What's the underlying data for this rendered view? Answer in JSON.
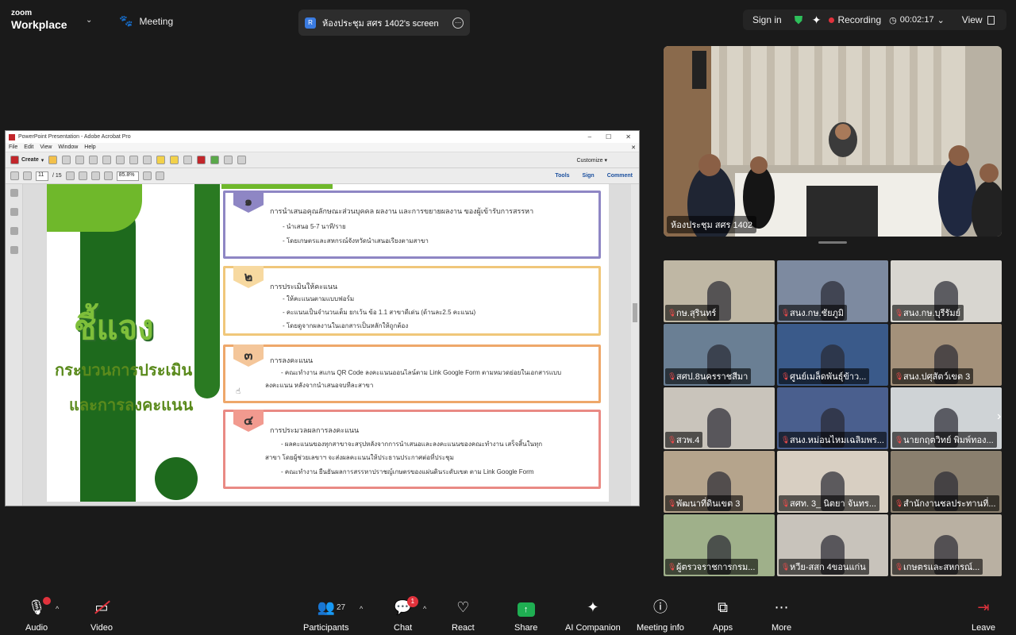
{
  "app": {
    "logo_line1": "zoom",
    "logo_line2": "Workplace",
    "meeting_label": "Meeting",
    "share_tab_label": "ห้องประชุม สศร 1402's screen",
    "share_tab_icon": "R"
  },
  "status": {
    "signin": "Sign in",
    "recording": "Recording",
    "timer": "00:02:17",
    "view": "View"
  },
  "acrobat": {
    "title": "PowerPoint Presentation - Adobe Acrobat Pro",
    "menu": [
      "File",
      "Edit",
      "View",
      "Window",
      "Help"
    ],
    "create": "Create",
    "customize": "Customize",
    "page_current": "11",
    "page_total": "/ 15",
    "zoom": "85.8%",
    "tools": "Tools",
    "sign": "Sign",
    "comment": "Comment"
  },
  "slide": {
    "title_main": "ชี้แจง",
    "title_sub1": "กระบวนการประเมิน",
    "title_sub2": "และการลงคะแนน",
    "cards": [
      {
        "num": "๑",
        "title": "การนำเสนอคุณลักษณะส่วนบุคคล ผลงาน และการขยายผลงาน ของผู้เข้ารับการสรรหา",
        "lines": [
          "- นำเสนอ 5-7 นาที/ราย",
          "- โดยเกษตรและสหกรณ์จังหวัดนำเสนอเรียงตามสาขา"
        ]
      },
      {
        "num": "๒",
        "title": "การประเมินให้คะแนน",
        "lines": [
          "- ให้คะแนนตามแบบฟอร์ม",
          "- คะแนนเป็นจำนวนเต็ม ยกเว้น ข้อ 1.1 สาขาดีเด่น (ด้านละ2.5 คะแนน)",
          "- โดยดูจากผลงานในเอกสารเป็นหลักให้ถูกต้อง"
        ]
      },
      {
        "num": "๓",
        "title": "การลงคะแนน",
        "lines": [
          "- คณะทำงาน สแกน QR Code ลงคะแนนออนไลน์ตาม  Link Google Form ตามหมวดย่อยในเอกสารแบบ",
          "ลงคะแนน หลังจากนำเสนอจบทีละสาขา"
        ]
      },
      {
        "num": "๔",
        "title": "การประมวลผลการลงคะแนน",
        "lines": [
          "- ผลคะแนนของทุกสาขาจะสรุปหลังจากการนำเสนอและลงคะแนนของคณะทำงาน เสร็จสิ้นในทุก",
          "สาขา โดยผู้ช่วยเลขาฯ จะส่งผลคะแนนให้ประธานประกาศต่อที่ประชุม",
          "- คณะทำงาน ยืนยันผลการสรรหาปราชญ์เกษตรของแผ่นดินระดับเขต ตาม Link Google Form"
        ]
      }
    ]
  },
  "active_speaker": {
    "name": "ห้องประชุม สศร 1402"
  },
  "participants_grid": [
    "กษ.สุรินทร์",
    "สนง.กษ.ชัยภูมิ",
    "สนง.กษ.บุรีรัมย์",
    "สศป.8นครราชสีมา",
    "ศูนย์เมล็ดพันธุ์ข้าว...",
    "สนง.ปศุสัตว์เขต 3",
    "สวพ.4",
    "สนง.หม่อนไหมเฉลิมพร...",
    "นายกฤตวิทย์ พิมพ์ทอง...",
    "พัฒนาที่ดินเขต 3",
    "สศท. 3_ นิตยา จันทร...",
    "สำนักงานชลประทานที่...",
    "ผู้ตรวจราชการกรม...",
    "หวีย-สสก 4ขอนแก่น",
    "เกษตรและสหกรณ์..."
  ],
  "toolbar": {
    "audio": "Audio",
    "video": "Video",
    "participants": "Participants",
    "participants_count": "27",
    "chat": "Chat",
    "chat_badge": "1",
    "react": "React",
    "share": "Share",
    "ai_companion": "AI Companion",
    "meeting_info": "Meeting info",
    "apps": "Apps",
    "more": "More",
    "leave": "Leave"
  },
  "colors": {
    "background": "#1a1a1a",
    "record_red": "#e0323c",
    "share_green": "#1fae52",
    "shield_green": "#2ec05b",
    "slide_dark_green": "#1e6a1d",
    "slide_light_green": "#7ebf3a",
    "card1_border": "#8e86c4",
    "card2_border": "#f0c77a",
    "card3_border": "#eea76a",
    "card4_border": "#e98a84"
  }
}
